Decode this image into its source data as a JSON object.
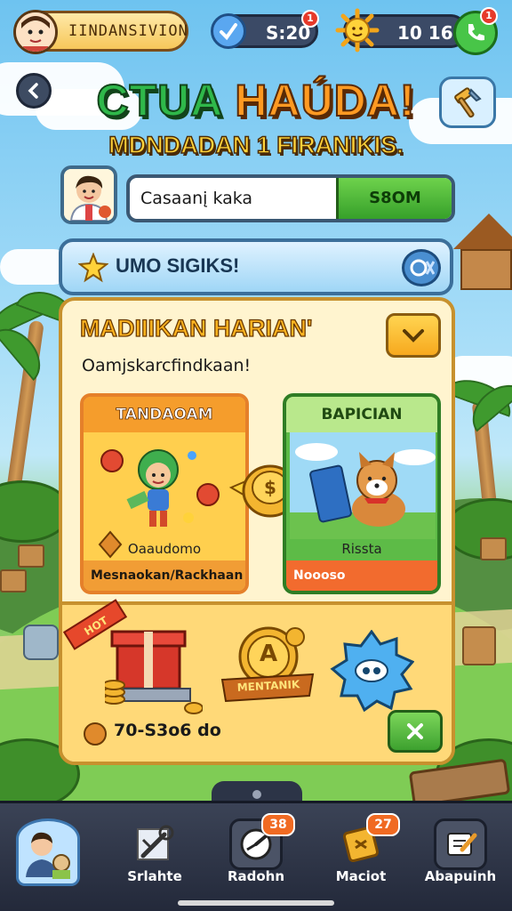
{
  "player": {
    "name": "IINDANSIVION"
  },
  "stats": [
    {
      "value": "S:20",
      "badge": "1"
    },
    {
      "value": "10 16",
      "badge": "1"
    }
  ],
  "title": {
    "part1": "CTUA",
    "part2": "HAÚDA!"
  },
  "subtitle": "MDNDADAN 1 FIRANIKIS.",
  "search": {
    "value": "Casaanį kaka",
    "button": "S8OM"
  },
  "banner": {
    "label": "UMO SIGIKS!"
  },
  "panel": {
    "title": "MADIIIKAN HARIAN'",
    "subtitle": "Oamjskarcfindkaan!",
    "cards": [
      {
        "header": "TANDAOAM",
        "caption": "Oaaudomo",
        "footer": "Mesnaokan/Rackhaan"
      },
      {
        "header": "BAPICIAN",
        "caption": "Rissta",
        "footer": "Noooso"
      }
    ],
    "rewards": {
      "ribbon": "HOT",
      "coin_label": "MENTANIK",
      "coin_letter": "A",
      "amount": "70-S3o6 do"
    }
  },
  "nav": [
    {
      "label": "",
      "badge": ""
    },
    {
      "label": "Srlahte",
      "badge": ""
    },
    {
      "label": "Radohn",
      "badge": "38"
    },
    {
      "label": "Maciot",
      "badge": "27"
    },
    {
      "label": "Abapuinh",
      "badge": ""
    }
  ],
  "colors": {
    "accent_green": "#36a02a",
    "accent_orange": "#f59d2c",
    "panel_bg": "#fff4cf",
    "nav_bg": "#2c3447"
  }
}
